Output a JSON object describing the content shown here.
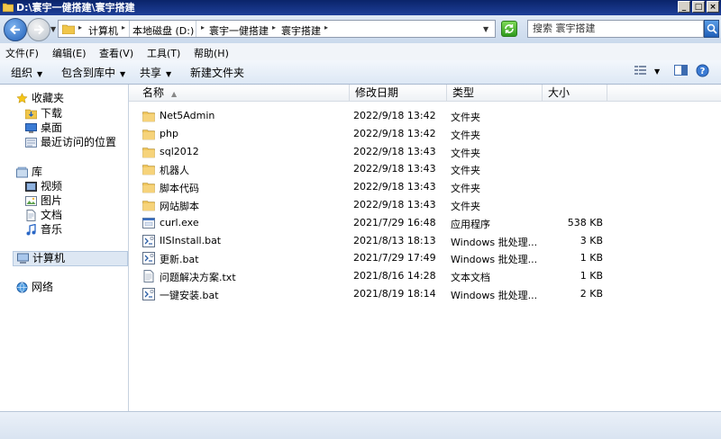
{
  "window": {
    "title": "D:\\寰宇一健搭建\\寰宇搭建"
  },
  "address": {
    "crumbs": [
      "计算机",
      "本地磁盘 (D:)",
      "寰宇一健搭建",
      "寰宇搭建"
    ],
    "search_placeholder": "搜索 寰宇搭建"
  },
  "menu": [
    "文件(F)",
    "编辑(E)",
    "查看(V)",
    "工具(T)",
    "帮助(H)"
  ],
  "commands": [
    "组织",
    "包含到库中",
    "共享",
    "新建文件夹"
  ],
  "navpane": {
    "favorites": "收藏夹",
    "favorites_items": [
      "下载",
      "桌面",
      "最近访问的位置"
    ],
    "libraries": "库",
    "libraries_items": [
      "视频",
      "图片",
      "文档",
      "音乐"
    ],
    "computer": "计算机",
    "network": "网络"
  },
  "columns": [
    "名称",
    "修改日期",
    "类型",
    "大小"
  ],
  "files": [
    {
      "name": "Net5Admin",
      "date": "2022/9/18 13:42",
      "type": "文件夹",
      "size": "",
      "icon": "folder-icon"
    },
    {
      "name": "php",
      "date": "2022/9/18 13:42",
      "type": "文件夹",
      "size": "",
      "icon": "folder-icon"
    },
    {
      "name": "sql2012",
      "date": "2022/9/18 13:43",
      "type": "文件夹",
      "size": "",
      "icon": "folder-icon"
    },
    {
      "name": "机器人",
      "date": "2022/9/18 13:43",
      "type": "文件夹",
      "size": "",
      "icon": "folder-icon"
    },
    {
      "name": "脚本代码",
      "date": "2022/9/18 13:43",
      "type": "文件夹",
      "size": "",
      "icon": "folder-icon"
    },
    {
      "name": "网站脚本",
      "date": "2022/9/18 13:43",
      "type": "文件夹",
      "size": "",
      "icon": "folder-icon"
    },
    {
      "name": "curl.exe",
      "date": "2021/7/29 16:48",
      "type": "应用程序",
      "size": "538 KB",
      "icon": "exe-icon"
    },
    {
      "name": "IISInstall.bat",
      "date": "2021/8/13 18:13",
      "type": "Windows 批处理...",
      "size": "3 KB",
      "icon": "bat-icon"
    },
    {
      "name": "更新.bat",
      "date": "2021/7/29 17:49",
      "type": "Windows 批处理...",
      "size": "1 KB",
      "icon": "bat-icon"
    },
    {
      "name": "问题解决方案.txt",
      "date": "2021/8/16 14:28",
      "type": "文本文档",
      "size": "1 KB",
      "icon": "txt-icon"
    },
    {
      "name": "一键安装.bat",
      "date": "2021/8/19 18:14",
      "type": "Windows 批处理...",
      "size": "2 KB",
      "icon": "bat-icon"
    }
  ],
  "colors": {
    "titlebar": "#0a246a",
    "folder": "#e8b84a",
    "selection": "#dde7f3"
  }
}
